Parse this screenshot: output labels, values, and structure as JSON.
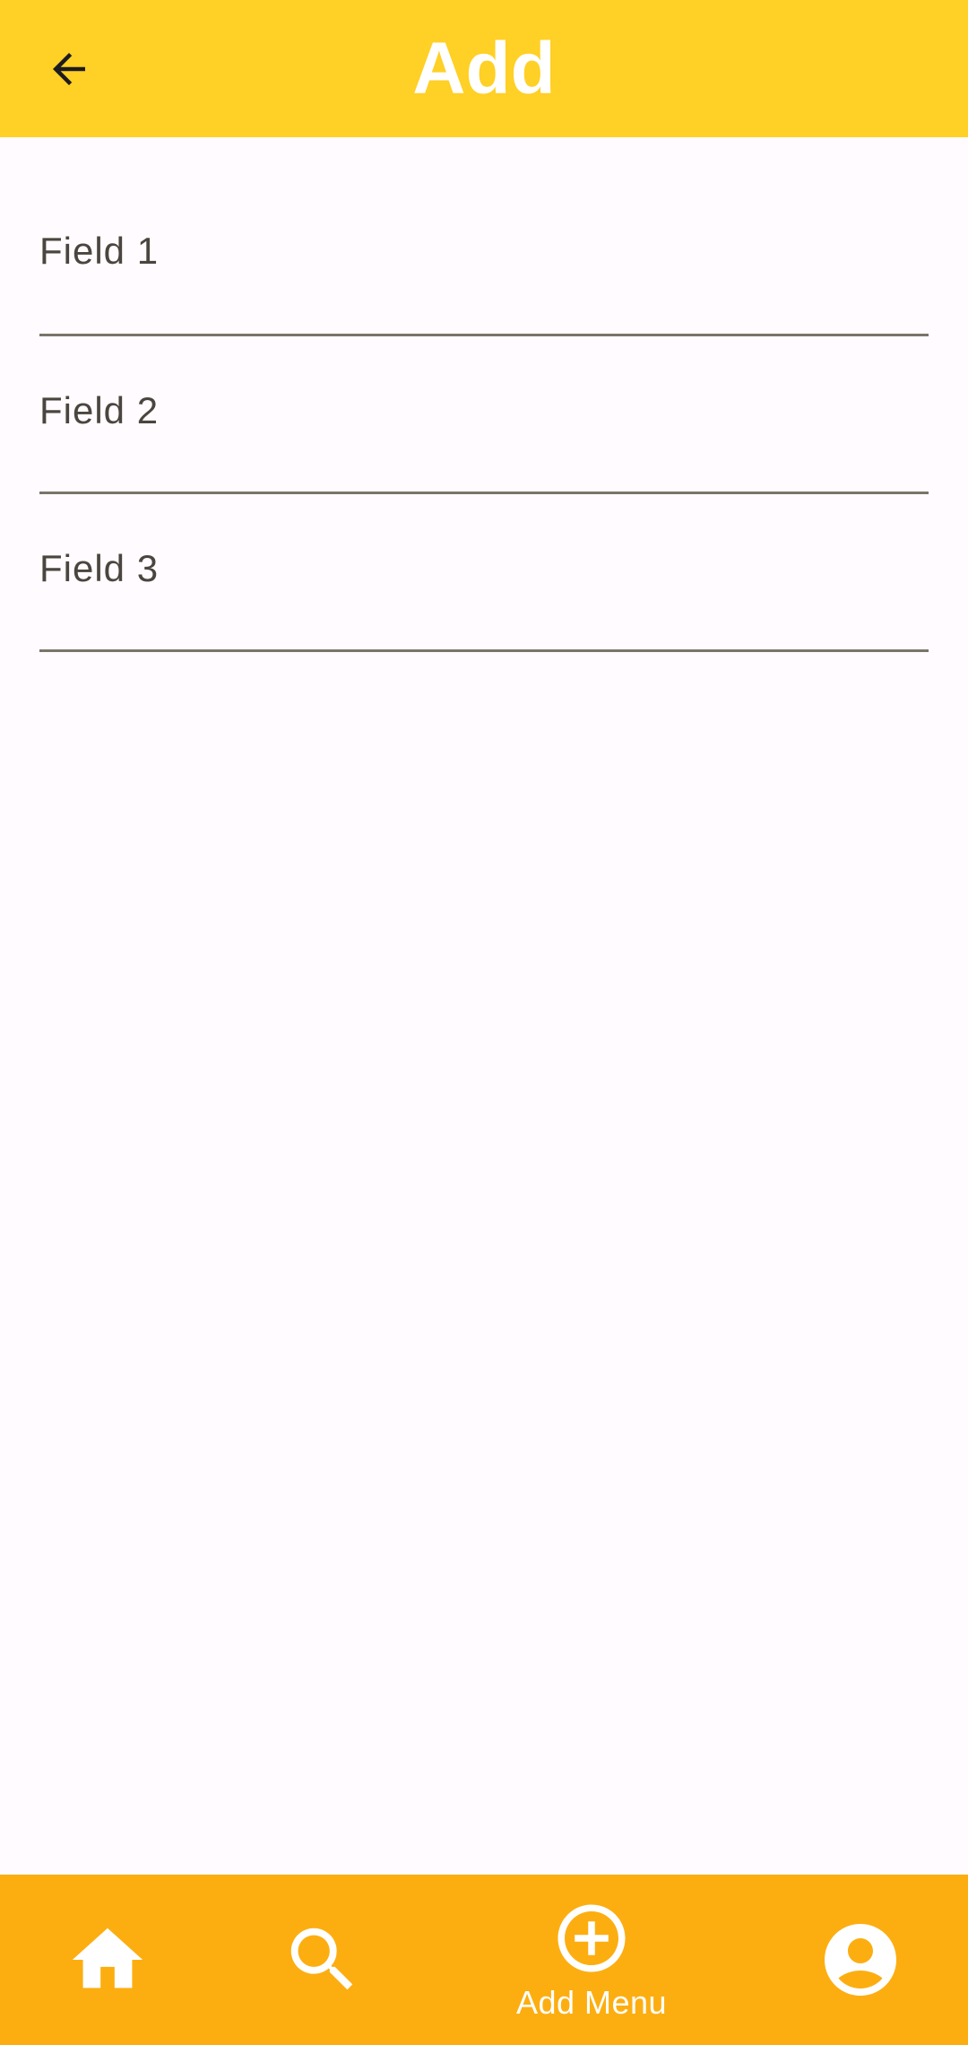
{
  "app_bar": {
    "title": "Add",
    "back_icon": "arrow-back-icon",
    "background": "#FFD025"
  },
  "form": {
    "fields": [
      {
        "label": "Field 1",
        "value": ""
      },
      {
        "label": "Field 2",
        "value": ""
      },
      {
        "label": "Field 3",
        "value": ""
      }
    ]
  },
  "bottom_nav": {
    "background": "#FCAE11",
    "items": [
      {
        "icon": "home-icon",
        "label": ""
      },
      {
        "icon": "search-icon",
        "label": ""
      },
      {
        "icon": "add-circle-icon",
        "label": "Add Menu"
      },
      {
        "icon": "account-circle-icon",
        "label": ""
      }
    ]
  }
}
